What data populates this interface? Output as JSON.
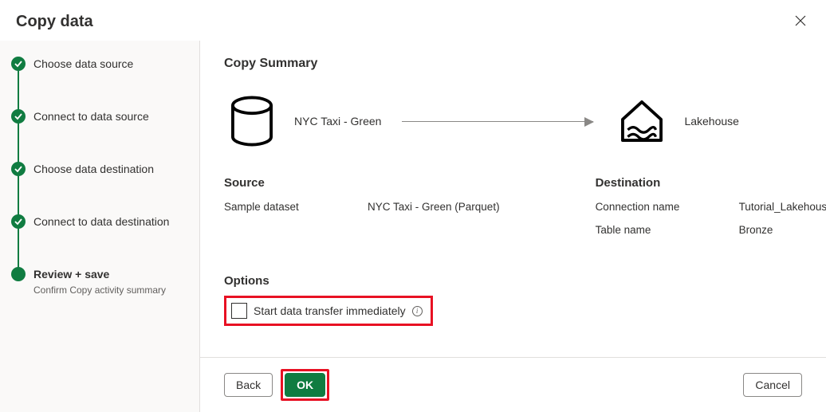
{
  "header": {
    "title": "Copy data"
  },
  "sidebar": {
    "steps": [
      {
        "label": "Choose data source",
        "completed": true
      },
      {
        "label": "Connect to data source",
        "completed": true
      },
      {
        "label": "Choose data destination",
        "completed": true
      },
      {
        "label": "Connect to data destination",
        "completed": true
      },
      {
        "label": "Review + save",
        "active": true,
        "sub": "Confirm Copy activity summary"
      }
    ]
  },
  "main": {
    "title": "Copy Summary",
    "source_name": "NYC Taxi - Green",
    "destination_name": "Lakehouse",
    "source": {
      "heading": "Source",
      "rows": [
        {
          "k": "Sample dataset",
          "v": "NYC Taxi - Green (Parquet)"
        }
      ]
    },
    "destination": {
      "heading": "Destination",
      "rows": [
        {
          "k": "Connection name",
          "v": "Tutorial_Lakehouse"
        },
        {
          "k": "Table name",
          "v": "Bronze"
        }
      ]
    },
    "options": {
      "heading": "Options",
      "checkbox_label": "Start data transfer immediately",
      "checked": false
    }
  },
  "footer": {
    "back": "Back",
    "ok": "OK",
    "cancel": "Cancel"
  }
}
